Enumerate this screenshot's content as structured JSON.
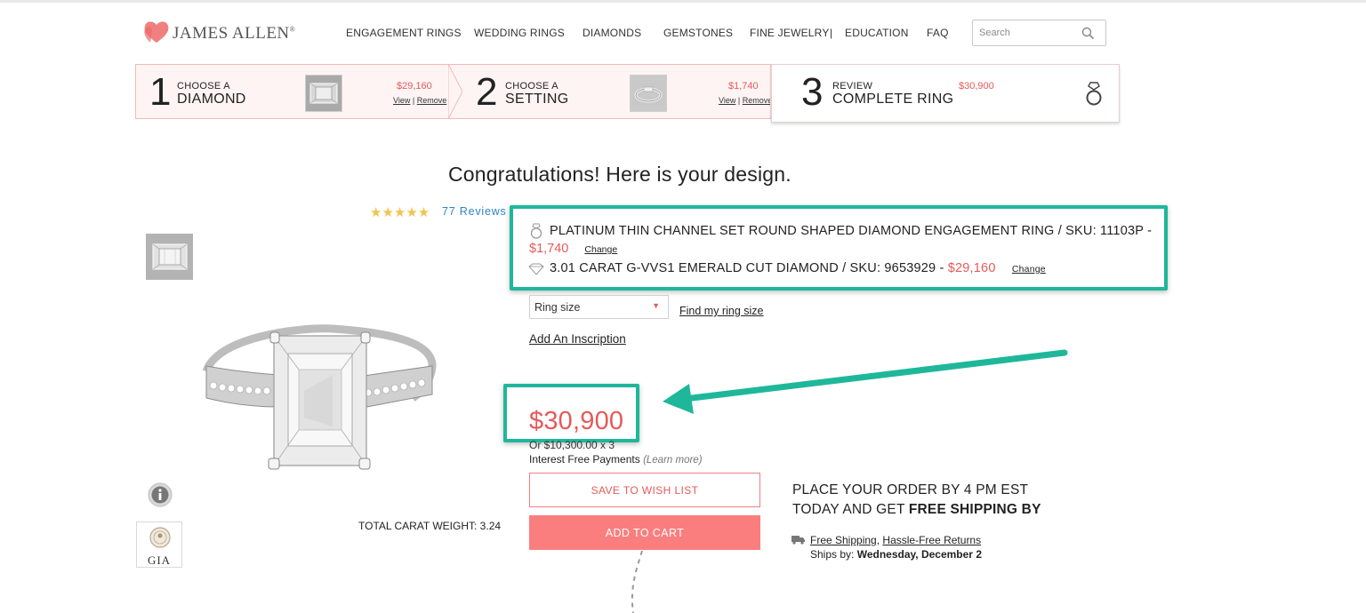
{
  "brand": {
    "name": "JAMES ALLEN",
    "trademark": "®"
  },
  "nav": {
    "items": [
      "ENGAGEMENT RINGS",
      "WEDDING RINGS",
      "DIAMONDS",
      "GEMSTONES",
      "FINE JEWELRY",
      "EDUCATION",
      "FAQ"
    ],
    "separator": "|"
  },
  "search": {
    "placeholder": "Search"
  },
  "steps": [
    {
      "number": "1",
      "line1": "CHOOSE A",
      "line2": "DIAMOND",
      "price": "$29,160",
      "view": "View",
      "sep": "|",
      "remove": "Remove"
    },
    {
      "number": "2",
      "line1": "CHOOSE A",
      "line2": "SETTING",
      "price": "$1,740",
      "view": "View",
      "sep": "|",
      "remove": "Remove"
    },
    {
      "number": "3",
      "line1": "REVIEW",
      "line2": "COMPLETE RING",
      "price": "$30,900"
    }
  ],
  "main": {
    "heading": "Congratulations! Here is your design.",
    "stars": "★★★★★",
    "reviews": "77 Reviews",
    "total_carat": "TOTAL CARAT WEIGHT: 3.24",
    "gia_label": "GIA"
  },
  "components": {
    "setting_text": "PLATINUM THIN CHANNEL SET ROUND SHAPED DIAMOND ENGAGEMENT RING / SKU: 11103P -",
    "setting_price": "$1,740",
    "diamond_text": "3.01 CARAT G-VVS1 EMERALD CUT DIAMOND / SKU: 9653929 -",
    "diamond_price": "$29,160",
    "change_label": "Change"
  },
  "options": {
    "ring_size_label": "Ring size",
    "find_size": "Find my ring size",
    "inscription": "Add An Inscription"
  },
  "pricing": {
    "total": "$30,900",
    "installment": "Or $10,300.00 x 3",
    "interest": "Interest Free Payments",
    "learn_more": "(Learn more)"
  },
  "actions": {
    "wishlist": "SAVE TO WISH LIST",
    "add_to_cart": "ADD TO CART"
  },
  "shipping": {
    "line1": "PLACE YOUR ORDER BY 4 PM EST",
    "line2_prefix": "TODAY AND GET ",
    "line2_bold": "FREE SHIPPING BY",
    "free_shipping": "Free Shipping",
    "comma": ",",
    "returns": "Hassle-Free Returns",
    "ships_by_label": "Ships by: ",
    "ships_by_date": "Wednesday, December 2"
  },
  "colors": {
    "accent": "#e55a5a",
    "button": "#fb7e7e",
    "annotation": "#1fb79a",
    "link_blue": "#2a86c8",
    "stars": "#f2c34e"
  }
}
